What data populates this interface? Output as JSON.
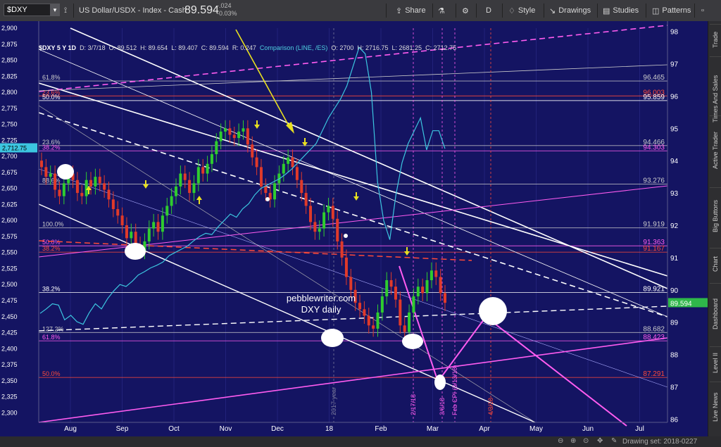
{
  "toolbar": {
    "symbol": "$DXY",
    "description": "US Dollar/USDX - Index - Cash",
    "last_price": "89.594",
    "change": "-.024",
    "change_pct": "-0.03%",
    "share": "Share",
    "period": "D",
    "style": "Style",
    "drawings": "Drawings",
    "studies": "Studies",
    "patterns": "Patterns"
  },
  "chart_info": {
    "title": "$DXY 5 Y 1D",
    "date": "D: 3/7/18",
    "open": "O: 89.512",
    "high": "H: 89.654",
    "low": "L: 89.407",
    "close": "C: 89.594",
    "range": "R: 0.247",
    "comparison": "Comparison (LINE, /ES)",
    "cmp_open": "O: 2700",
    "cmp_high": "H: 2716.75",
    "cmp_low": "L: 2681.25",
    "cmp_close": "C: 2712.75"
  },
  "watermark": {
    "line1": "pebblewriter.com",
    "line2": "DXY daily"
  },
  "left_current": "2,712.75",
  "right_current": "89.594",
  "status_bar": {
    "drawing_set": "Drawing set: 2018-0227"
  },
  "right_tabs": [
    "Trade",
    "Times And Sales",
    "Active Trader",
    "Big Buttons",
    "Chart",
    "Dashboard",
    "Level II",
    "Live News"
  ],
  "colors": {
    "chart_bg": "#141462",
    "up_candle": "#2fcc2f",
    "down_candle": "#e03a2a",
    "comparison": "#3cc6e0",
    "fib_pink": "#ff5cf0",
    "accent_red": "#ff4a3a"
  },
  "chart_data": {
    "type": "line",
    "title": "$DXY 5 Y 1D",
    "left_axis": {
      "ticks": [
        "2,900",
        "2,875",
        "2,850",
        "2,825",
        "2,800",
        "2,775",
        "2,750",
        "2,725",
        "2,700",
        "2,675",
        "2,650",
        "2,625",
        "2,600",
        "2,575",
        "2,550",
        "2,525",
        "2,500",
        "2,475",
        "2,450",
        "2,425",
        "2,400",
        "2,375",
        "2,350",
        "2,325",
        "2,300"
      ],
      "ylim": [
        2285,
        2900
      ]
    },
    "right_axis": {
      "ticks": [
        "98",
        "97",
        "96",
        "95",
        "94",
        "93",
        "92",
        "91",
        "90",
        "89",
        "88",
        "87",
        "86"
      ],
      "ylim": [
        85.9,
        98.1
      ]
    },
    "x_ticks": [
      "Aug",
      "Sep",
      "Oct",
      "Nov",
      "Dec",
      "18",
      "Feb",
      "Mar",
      "Apr",
      "May",
      "Jun",
      "Jul"
    ],
    "fib_levels": [
      {
        "label": "61.8%",
        "value": 96.465,
        "color": "#cccccc"
      },
      {
        "label": "23.6%",
        "value": 96.003,
        "color": "#ff4a3a"
      },
      {
        "label": "50.0%",
        "value": 95.859,
        "color": "#ffffff"
      },
      {
        "label": "23.6%",
        "value": 94.466,
        "color": "#cccccc"
      },
      {
        "label": "38.2%",
        "value": 94.303,
        "color": "#ff5cf0"
      },
      {
        "label": "88.6%",
        "value": 93.276,
        "color": "#cccccc"
      },
      {
        "label": "100.0%",
        "value": 91.919,
        "color": "#cccccc"
      },
      {
        "label": "50.0%",
        "value": 91.363,
        "color": "#ff5cf0"
      },
      {
        "label": "38.2%",
        "value": 91.167,
        "color": "#ff4a3a"
      },
      {
        "label": "38.2%",
        "value": 89.921,
        "color": "#ffffff"
      },
      {
        "label": "127.2%",
        "value": 88.682,
        "color": "#cccccc"
      },
      {
        "label": "61.8%",
        "value": 88.423,
        "color": "#ff5cf0"
      },
      {
        "label": "50.0%",
        "value": 87.291,
        "color": "#ff4a3a"
      }
    ],
    "vertical_markers": [
      "2017 year",
      "2/17/18",
      "3/6/18",
      "Feb CPI (3/13/18)",
      "4/3/18"
    ],
    "dxy_close": [
      93.8,
      93.5,
      93.6,
      93.1,
      92.9,
      93.3,
      93.6,
      93.4,
      93.0,
      92.9,
      93.4,
      93.2,
      93.5,
      93.3,
      93.1,
      92.8,
      92.5,
      92.3,
      92.0,
      91.6,
      91.8,
      91.4,
      91.2,
      91.5,
      91.9,
      92.1,
      91.8,
      92.3,
      92.6,
      92.9,
      93.2,
      93.6,
      93.4,
      93.0,
      93.3,
      93.8,
      93.6,
      93.9,
      94.2,
      94.6,
      94.9,
      95.0,
      94.8,
      94.7,
      94.9,
      95.0,
      94.5,
      94.1,
      93.8,
      93.2,
      93.0,
      92.8,
      93.3,
      93.6,
      93.9,
      94.1,
      93.8,
      93.4,
      93.0,
      92.6,
      92.1,
      91.8,
      91.9,
      92.4,
      92.6,
      92.2,
      91.5,
      91.0,
      90.4,
      90.0,
      89.6,
      89.4,
      89.2,
      88.9,
      88.8,
      89.3,
      89.8,
      90.3,
      90.1,
      89.7,
      88.9,
      88.7,
      89.3,
      89.8,
      90.1,
      89.9,
      90.3,
      90.6,
      90.4,
      89.9,
      89.6
    ],
    "es_comparison": [
      2455,
      2462,
      2470,
      2468,
      2445,
      2452,
      2442,
      2438,
      2456,
      2470,
      2462,
      2478,
      2490,
      2500,
      2497,
      2505,
      2515,
      2520,
      2526,
      2530,
      2535,
      2545,
      2550,
      2555,
      2560,
      2568,
      2575,
      2580,
      2578,
      2590,
      2600,
      2610,
      2605,
      2618,
      2626,
      2640,
      2650,
      2655,
      2660,
      2665,
      2672,
      2680,
      2690,
      2700,
      2710,
      2720,
      2740,
      2760,
      2775,
      2790,
      2810,
      2840,
      2870,
      2860,
      2800,
      2660,
      2600,
      2570,
      2640,
      2690,
      2720,
      2740,
      2760,
      2710,
      2740,
      2740,
      2712
    ]
  }
}
